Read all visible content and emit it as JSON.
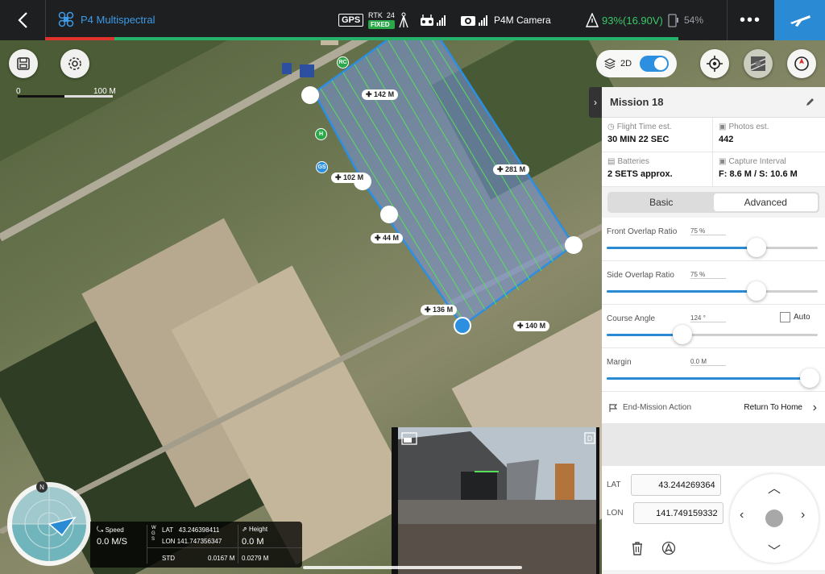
{
  "topbar": {
    "aircraft_name": "P4 Multispectral",
    "gps_label": "GPS",
    "rtk_label": "RTK",
    "rtk_count": "24",
    "rtk_status": "FIXED",
    "camera_label": "P4M Camera",
    "aircraft_battery": "93%(16.90V)",
    "device_battery": "54%",
    "more": "•••"
  },
  "map": {
    "scale_start": "0",
    "scale_end": "100 M",
    "toggle_label": "2D",
    "marker_rc": "RC",
    "marker_gs": "GS",
    "marker_h": "H",
    "distances": [
      "142 M",
      "281 M",
      "102 M",
      "44 M",
      "136 M",
      "140 M"
    ]
  },
  "mission": {
    "title": "Mission 18",
    "flight_time_label": "Flight Time est.",
    "flight_time_value": "30 MIN 22 SEC",
    "photos_label": "Photos est.",
    "photos_value": "442",
    "batteries_label": "Batteries",
    "batteries_value": "2 SETS approx.",
    "interval_label": "Capture Interval",
    "interval_value": "F: 8.6 M / S: 10.6 M",
    "tab_basic": "Basic",
    "tab_advanced": "Advanced",
    "front_overlap_label": "Front Overlap Ratio",
    "front_overlap_value": "75 %",
    "front_overlap_level": 0.71,
    "side_overlap_label": "Side Overlap Ratio",
    "side_overlap_value": "75 %",
    "side_overlap_level": 0.71,
    "course_angle_label": "Course Angle",
    "course_angle_value": "124 °",
    "course_angle_level": 0.36,
    "auto_label": "Auto",
    "margin_label": "Margin",
    "margin_value": "0.0 M",
    "margin_level": 0.96,
    "end_action_label": "End-Mission Action",
    "end_action_value": "Return To Home",
    "lat_label": "LAT",
    "lat_value": "43.244269364",
    "lon_label": "LON",
    "lon_value": "141.749159332"
  },
  "telemetry": {
    "speed_label": "Speed",
    "speed_value": "0.0 M/S",
    "lat_label": "LAT",
    "lat_value": "43.246398411",
    "lon_label": "LON",
    "lon_value": "141.747356347",
    "std_label": "STD",
    "std_value_1": "0.0167 M",
    "std_value_2": "0.0279 M",
    "height_label": "Height",
    "height_value": "0.0 M",
    "compass_north": "N",
    "wgs_label": "W G S"
  },
  "colors": {
    "accent": "#2a8ad4",
    "signal_green": "#26b26a",
    "battery_green": "#3cc76a",
    "alert_red": "#e0322d",
    "flight_lines": "#56e05a"
  }
}
